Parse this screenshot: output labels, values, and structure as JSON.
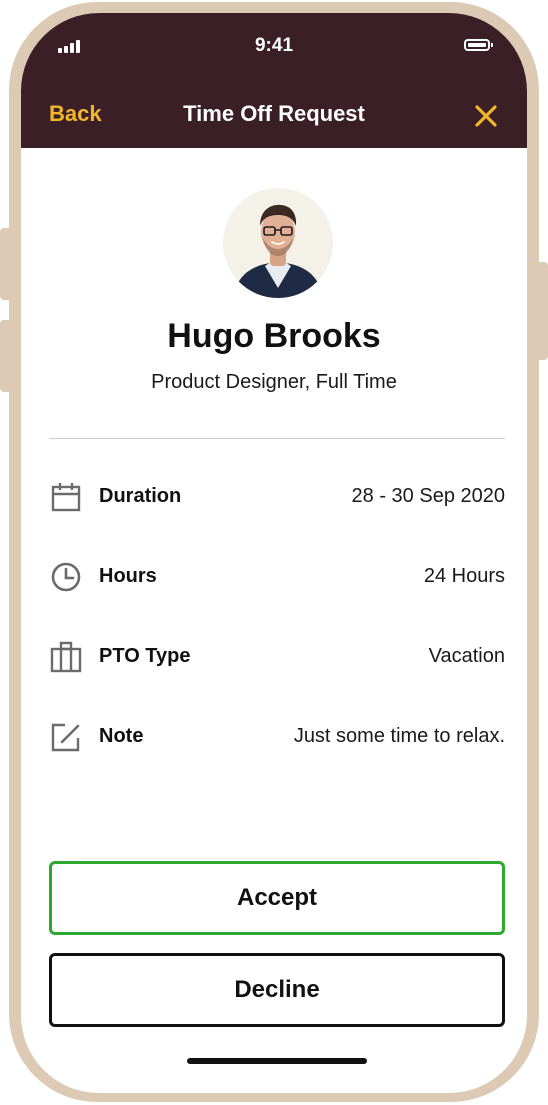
{
  "status_bar": {
    "time": "9:41"
  },
  "nav": {
    "back_label": "Back",
    "title": "Time Off Request",
    "close_icon": "close-icon"
  },
  "profile": {
    "name": "Hugo Brooks",
    "role": "Product Designer, Full Time"
  },
  "details": [
    {
      "icon": "calendar-icon",
      "label": "Duration",
      "value": "28 - 30 Sep 2020"
    },
    {
      "icon": "clock-icon",
      "label": "Hours",
      "value": "24 Hours"
    },
    {
      "icon": "building-icon",
      "label": "PTO Type",
      "value": "Vacation"
    },
    {
      "icon": "edit-note-icon",
      "label": "Note",
      "value": "Just some time to relax."
    }
  ],
  "actions": {
    "accept_label": "Accept",
    "decline_label": "Decline"
  },
  "colors": {
    "header_background": "#3b1f27",
    "accent_yellow": "#f2b62b",
    "accept_border": "#2ea82e",
    "frame": "#dccab4"
  }
}
